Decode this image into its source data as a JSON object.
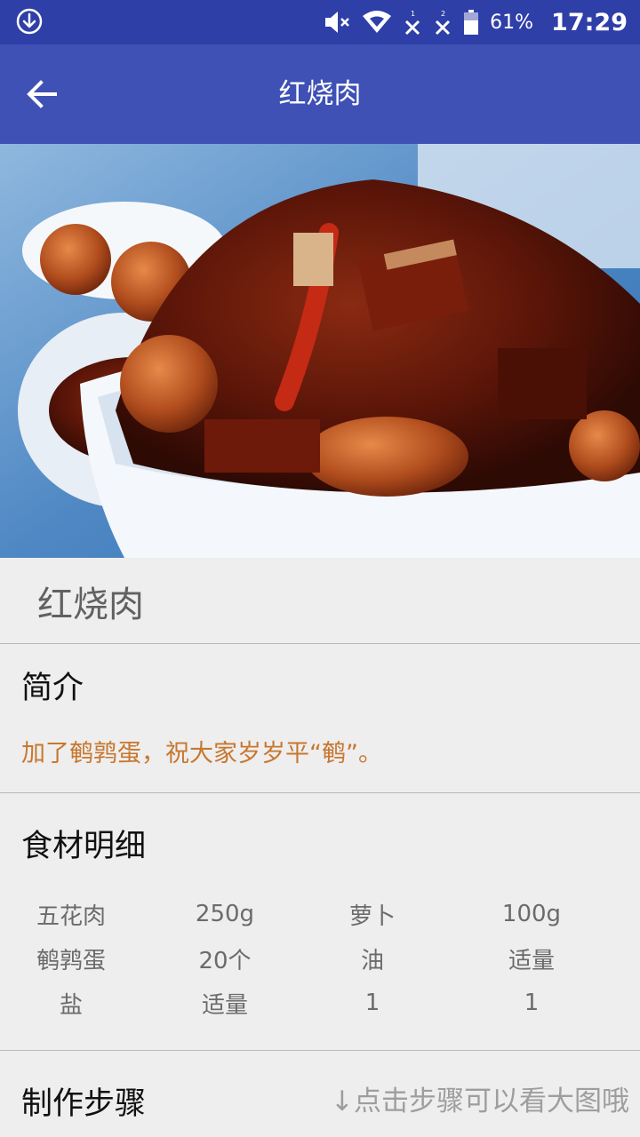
{
  "status_bar": {
    "battery": "61%",
    "time": "17:29",
    "icons": [
      "download-icon",
      "mute-icon",
      "wifi-icon",
      "no-signal-1-icon",
      "no-signal-2-icon",
      "battery-icon"
    ]
  },
  "toolbar": {
    "title": "红烧肉",
    "back_icon": "arrow-back-icon"
  },
  "recipe": {
    "name": "红烧肉",
    "intro_heading": "简介",
    "intro_text": "加了鹌鹑蛋，祝大家岁岁平“鹌”。",
    "ingredients_heading": "食材明细",
    "ingredients": [
      [
        "五花肉",
        "250g",
        "萝卜",
        "100g"
      ],
      [
        "鹌鹑蛋",
        "20个",
        "油",
        "适量"
      ],
      [
        "盐",
        "适量",
        "1",
        "1"
      ]
    ],
    "steps_heading": "制作步骤",
    "steps_hint": "↓点击步骤可以看大图哦"
  },
  "colors": {
    "status_bar": "#2f3fa8",
    "app_bar": "#3f51b5",
    "intro_text": "#c8772f",
    "background": "#eeeeee"
  }
}
